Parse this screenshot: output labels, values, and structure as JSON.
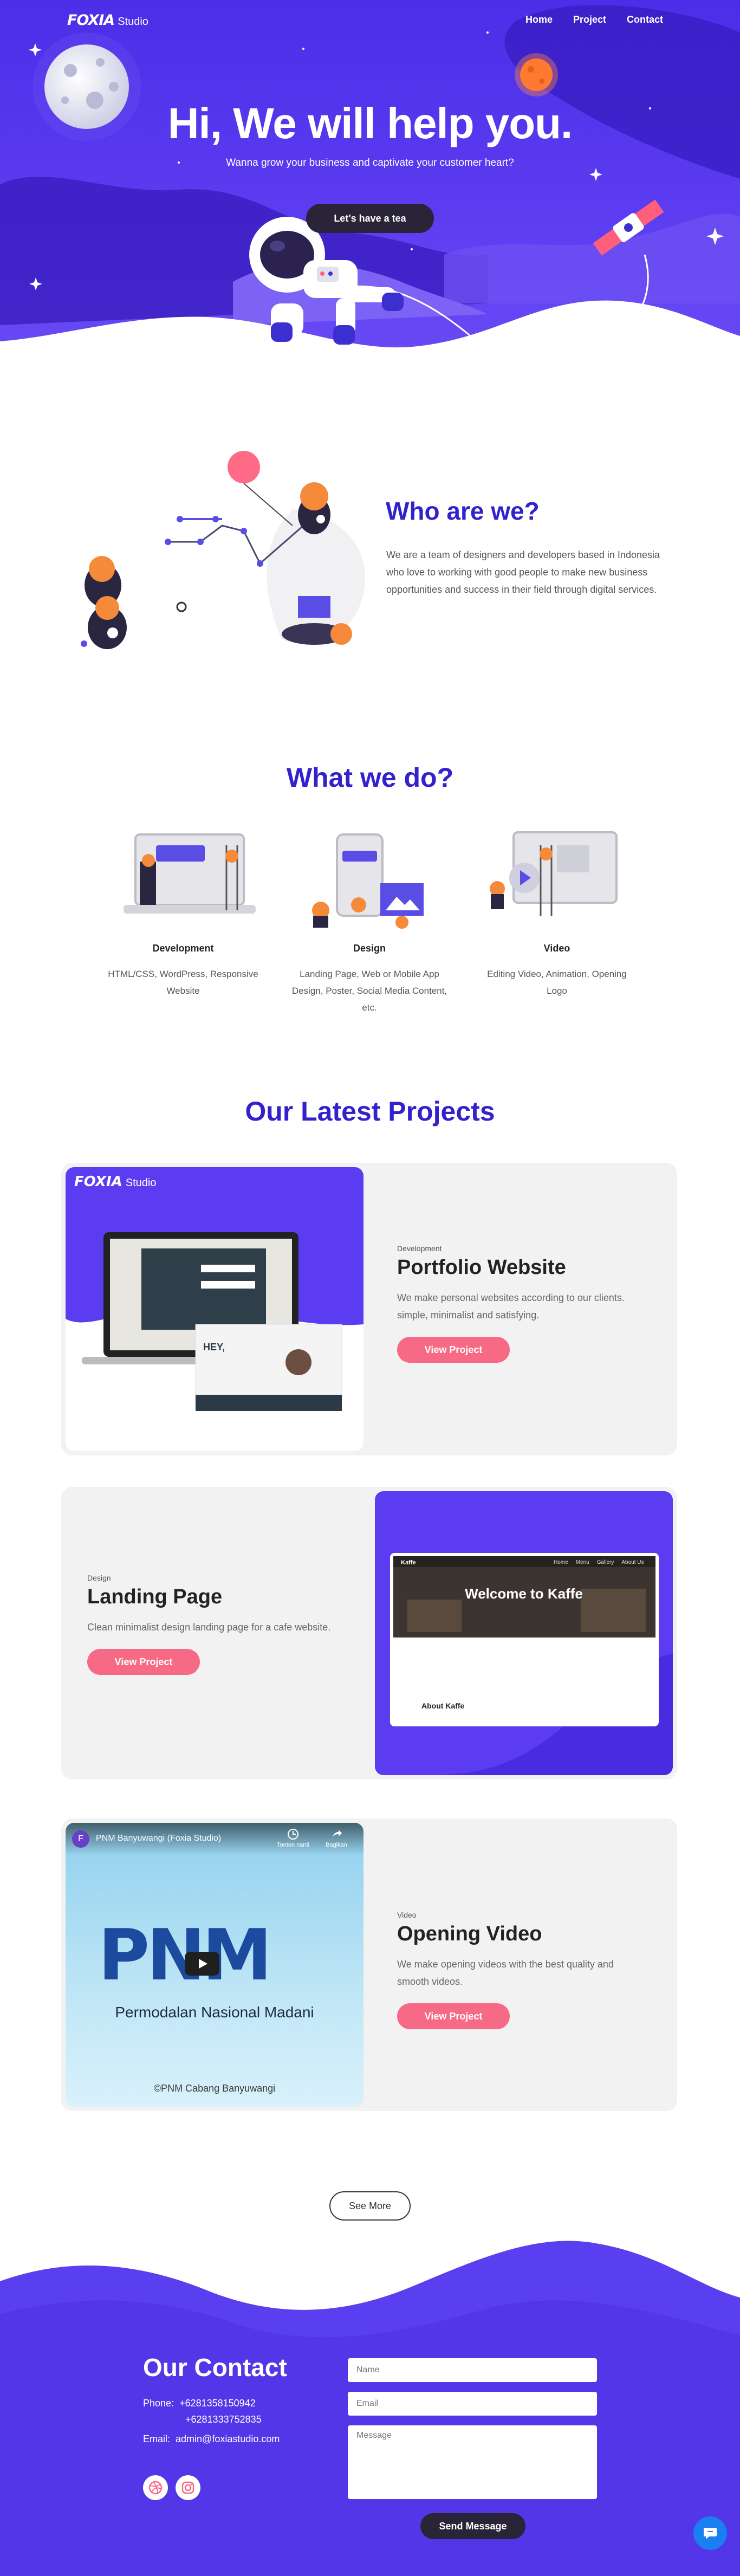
{
  "nav": {
    "logo_main": "FOXIA",
    "logo_sub": "Studio",
    "items": [
      "Home",
      "Project",
      "Contact"
    ]
  },
  "hero": {
    "title": "Hi, We will help you.",
    "subtitle": "Wanna grow your business and captivate your customer heart?",
    "cta": "Let's have a tea"
  },
  "about": {
    "title": "Who are we?",
    "text": "We are a team of designers and developers based in Indonesia who love to working with good people to make new business opportunities and success in their field through digital services."
  },
  "services": {
    "title": "What we do?",
    "items": [
      {
        "title": "Development",
        "desc": "HTML/CSS, WordPress, Responsive Website"
      },
      {
        "title": "Design",
        "desc": "Landing Page, Web or Mobile App Design, Poster, Social Media Content, etc."
      },
      {
        "title": "Video",
        "desc": "Editing Video, Animation, Opening Logo"
      }
    ]
  },
  "projects": {
    "title": "Our Latest Projects",
    "items": [
      {
        "category": "Development",
        "title": "Portfolio Website",
        "desc": "We make personal websites according to our clients. simple, minimalist and satisfying.",
        "button": "View Project",
        "thumb": {
          "logo_main": "FOXIA",
          "logo_sub": "Studio",
          "laptop_heading": "HEY,"
        }
      },
      {
        "category": "Design",
        "title": "Landing Page",
        "desc": "Clean minimalist design landing page for a cafe website.",
        "button": "View Project",
        "thumb": {
          "brand": "Kaffe",
          "menu": [
            "Home",
            "Menu",
            "Gallery",
            "About Us"
          ],
          "headline": "Welcome to Kaffe",
          "about": "About Kaffe"
        }
      },
      {
        "category": "Video",
        "title": "Opening Video",
        "desc": "We make opening videos with the best quality and smooth videos.",
        "button": "View Project",
        "thumb": {
          "channel_initial": "F",
          "video_title": "PNM Banyuwangi (Foxia Studio)",
          "watch_later": "Tonton nanti",
          "share": "Bagikan",
          "brand": "PNM",
          "tagline": "Permodalan Nasional Madani",
          "credit": "©PNM Cabang Banyuwangi"
        }
      }
    ],
    "see_more": "See More"
  },
  "contact": {
    "title": "Our Contact",
    "phone_label": "Phone:",
    "phones": [
      "+6281358150942",
      "+6281333752835"
    ],
    "email_label": "Email:",
    "email": "admin@foxiastudio.com",
    "form": {
      "name_ph": "Name",
      "email_ph": "Email",
      "message_ph": "Message",
      "send": "Send Message"
    }
  },
  "colors": {
    "primary": "#4b2ee8",
    "heading": "#3322cc",
    "accent": "#f76a86",
    "dark": "#2a2438",
    "card": "#f2f2f2"
  },
  "icons": [
    "dribbble-icon",
    "instagram-icon",
    "chat-icon",
    "play-icon",
    "share-icon",
    "clock-icon"
  ]
}
